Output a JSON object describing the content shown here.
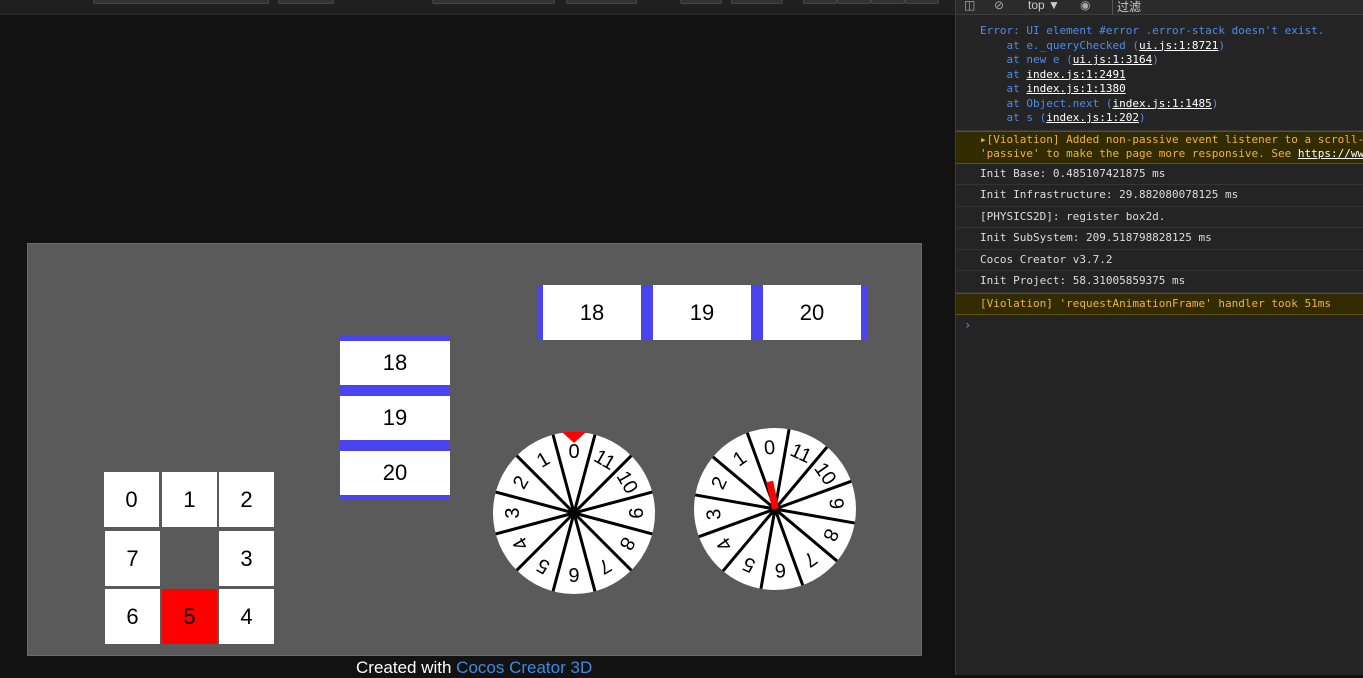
{
  "game": {
    "grid": [
      {
        "label": "0",
        "red": false
      },
      {
        "label": "1",
        "red": false
      },
      {
        "label": "2",
        "red": false
      },
      {
        "label": "7",
        "red": false
      },
      {
        "label": "3",
        "red": false
      },
      {
        "label": "6",
        "red": false
      },
      {
        "label": "5",
        "red": true
      },
      {
        "label": "4",
        "red": false
      }
    ],
    "vertical_list": [
      "18",
      "19",
      "20"
    ],
    "horizontal_list": [
      "18",
      "19",
      "20"
    ],
    "wheel_numbers": [
      "0",
      "11",
      "10",
      "9",
      "8",
      "7",
      "6",
      "5",
      "4",
      "3",
      "2",
      "1"
    ],
    "colors": {
      "stage": "#5a5a5a",
      "highlight": "#ff0000",
      "list_border": "#4a44f0"
    }
  },
  "footer": {
    "prefix": "Created with ",
    "link": "Cocos Creator 3D"
  },
  "devtools": {
    "context": "top ▼",
    "filter_placeholder": "过滤",
    "error": {
      "title": "Error: UI element #error .error-stack doesn't exist.",
      "stack": [
        {
          "pre": "    at e._queryChecked (",
          "link": "ui.js:1:8721",
          "post": ")"
        },
        {
          "pre": "    at new e (",
          "link": "ui.js:1:3164",
          "post": ")"
        },
        {
          "pre": "    at ",
          "link": "index.js:1:2491",
          "post": ""
        },
        {
          "pre": "    at ",
          "link": "index.js:1:1380",
          "post": ""
        },
        {
          "pre": "    at Object.next (",
          "link": "index.js:1:1485",
          "post": ")"
        },
        {
          "pre": "    at s (",
          "link": "index.js:1:202",
          "post": ")"
        }
      ]
    },
    "violation1_line1": "▸[Violation] Added non-passive event listener to a scroll-",
    "violation1_line2": "'passive' to make the page more responsive. See ",
    "violation1_link": "https://www",
    "logs": [
      "Init Base: 0.485107421875 ms",
      "Init Infrastructure: 29.882080078125 ms",
      "[PHYSICS2D]: register box2d.",
      "Init SubSystem: 209.518798828125 ms",
      "Cocos Creator v3.7.2",
      "Init Project: 58.31005859375 ms"
    ],
    "violation2": "[Violation] 'requestAnimationFrame' handler took 51ms",
    "prompt": "›"
  }
}
